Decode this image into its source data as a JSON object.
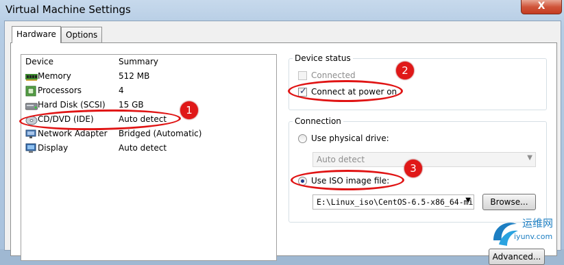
{
  "window": {
    "title": "Virtual Machine Settings",
    "close_glyph": "X"
  },
  "tabs": [
    {
      "label": "Hardware",
      "active": true
    },
    {
      "label": "Options",
      "active": false
    }
  ],
  "device_list": {
    "headers": {
      "device": "Device",
      "summary": "Summary"
    },
    "rows": [
      {
        "name": "Memory",
        "summary": "512 MB",
        "icon": "memory-icon"
      },
      {
        "name": "Processors",
        "summary": "4",
        "icon": "processor-icon"
      },
      {
        "name": "Hard Disk (SCSI)",
        "summary": "15 GB",
        "icon": "hard-disk-icon"
      },
      {
        "name": "CD/DVD (IDE)",
        "summary": "Auto detect",
        "icon": "cd-dvd-icon"
      },
      {
        "name": "Network Adapter",
        "summary": "Bridged (Automatic)",
        "icon": "network-adapter-icon"
      },
      {
        "name": "Display",
        "summary": "Auto detect",
        "icon": "display-icon"
      }
    ]
  },
  "device_status": {
    "label": "Device status",
    "connected": {
      "label": "Connected",
      "checked": false,
      "enabled": false
    },
    "connect_at_power_on": {
      "label": "Connect at power on",
      "checked": true
    }
  },
  "connection": {
    "label": "Connection",
    "physical_drive": {
      "label": "Use physical drive:",
      "selected": false
    },
    "physical_drive_select": {
      "value": "Auto detect",
      "enabled": false
    },
    "iso_image": {
      "label": "Use ISO image file:",
      "selected": true
    },
    "iso_path": {
      "value": "E:\\Linux_iso\\CentOS-6.5-x86_64-mi"
    },
    "browse_label": "Browse..."
  },
  "advanced_label": "Advanced...",
  "annotations": [
    "1",
    "2",
    "3"
  ],
  "annotation_color": "#e01414",
  "watermark": {
    "line1": "运维网",
    "line2": "iyunv.com"
  }
}
